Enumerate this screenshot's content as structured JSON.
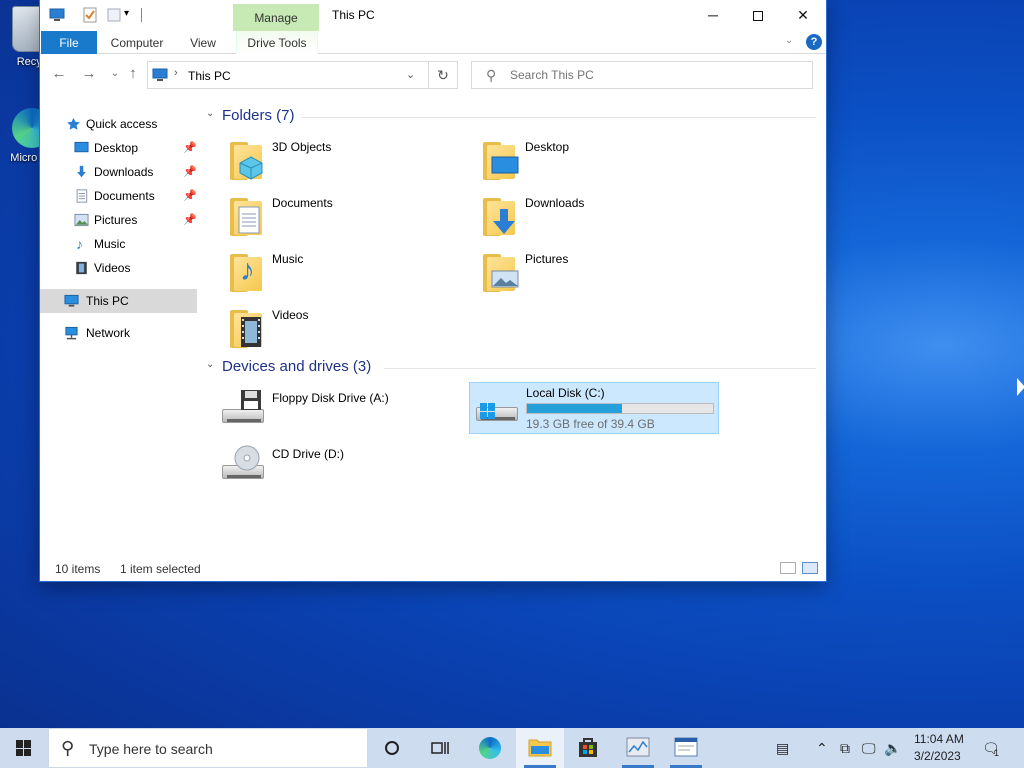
{
  "desktop": {
    "icons": [
      {
        "label": "Recyc"
      },
      {
        "label": "Micro Ed"
      }
    ]
  },
  "window": {
    "title": "This PC",
    "manage_tab": "Manage",
    "ribbon_tabs": {
      "file": "File",
      "computer": "Computer",
      "view": "View",
      "drive_tools": "Drive Tools"
    },
    "address": "This PC",
    "search_placeholder": "Search This PC"
  },
  "nav_pane": {
    "quick_access": "Quick access",
    "quick_items": [
      "Desktop",
      "Downloads",
      "Documents",
      "Pictures",
      "Music",
      "Videos"
    ],
    "this_pc": "This PC",
    "network": "Network"
  },
  "folders_group": {
    "title": "Folders (7)",
    "items": [
      "3D Objects",
      "Desktop",
      "Documents",
      "Downloads",
      "Music",
      "Pictures",
      "Videos"
    ]
  },
  "drives_group": {
    "title": "Devices and drives (3)",
    "floppy": "Floppy Disk Drive (A:)",
    "local_disk": {
      "label": "Local Disk (C:)",
      "free_text": "19.3 GB free of 39.4 GB",
      "used_fraction": 0.51
    },
    "cd": "CD Drive (D:)"
  },
  "status_bar": {
    "items_count": "10 items",
    "selection": "1 item selected"
  },
  "taskbar": {
    "search_text": "Type here to search",
    "time": "11:04 AM",
    "date": "3/2/2023",
    "notification_count": "1"
  },
  "colors": {
    "accent": "#1979ca",
    "manage_tab": "#c7e9b4",
    "selection": "#cce8ff",
    "disk_fill": "#26a0da"
  }
}
